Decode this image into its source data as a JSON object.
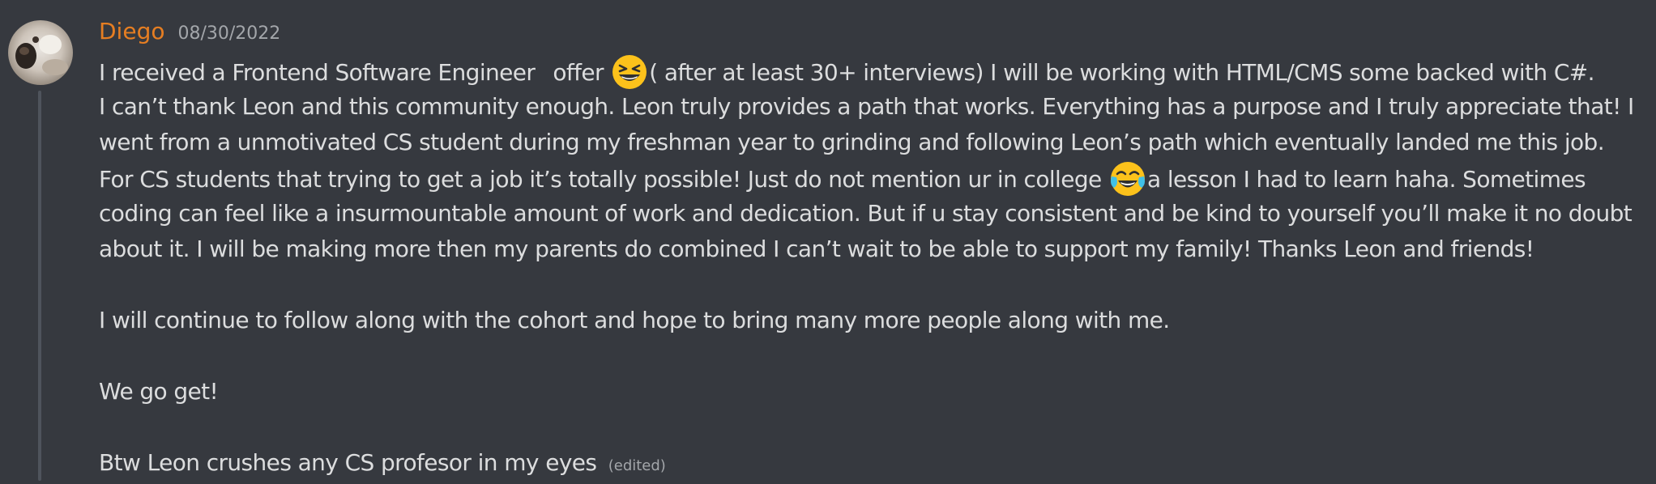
{
  "message": {
    "author": "Diego",
    "timestamp": "08/30/2022",
    "edited_label": "(edited)",
    "author_color": "#e67e22",
    "lines": [
      {
        "a": "I received a Frontend Software Engineer",
        "b": "offer",
        "emoji": "grinning-squinting-face-emoji",
        "c": "( after at least 30+ interviews) I will be working with HTML/CMS some backed with C#."
      },
      {
        "text": "I can’t thank Leon and this community enough. Leon truly provides a path that works. Everything has a purpose and I truly appreciate that! I"
      },
      {
        "text": "went from a unmotivated CS student during my freshman year to grinding and following Leon’s path which eventually landed me this job."
      },
      {
        "a": "For CS students that trying to get a job it’s totally possible! Just do not mention ur in college",
        "emoji": "face-with-tears-of-joy-emoji",
        "c": "a lesson I had to learn haha. Sometimes"
      },
      {
        "text": "coding can feel like a insurmountable amount of work and dedication. But if u stay consistent and be kind to yourself you’ll make it no doubt"
      },
      {
        "text": "about it. I will be making more then my parents do combined I can’t wait to be able to support my family! Thanks Leon and friends!"
      },
      {
        "text": ""
      },
      {
        "text": "I will continue to follow along with the cohort and hope to bring many more people along with me."
      },
      {
        "text": ""
      },
      {
        "text": "We go get!"
      },
      {
        "text": ""
      },
      {
        "text": "Btw Leon crushes any CS profesor in my eyes"
      }
    ]
  },
  "colors": {
    "background": "#36393f",
    "text": "#dcddde",
    "muted": "#a3a6aa",
    "thread_line": "#4f545c"
  }
}
